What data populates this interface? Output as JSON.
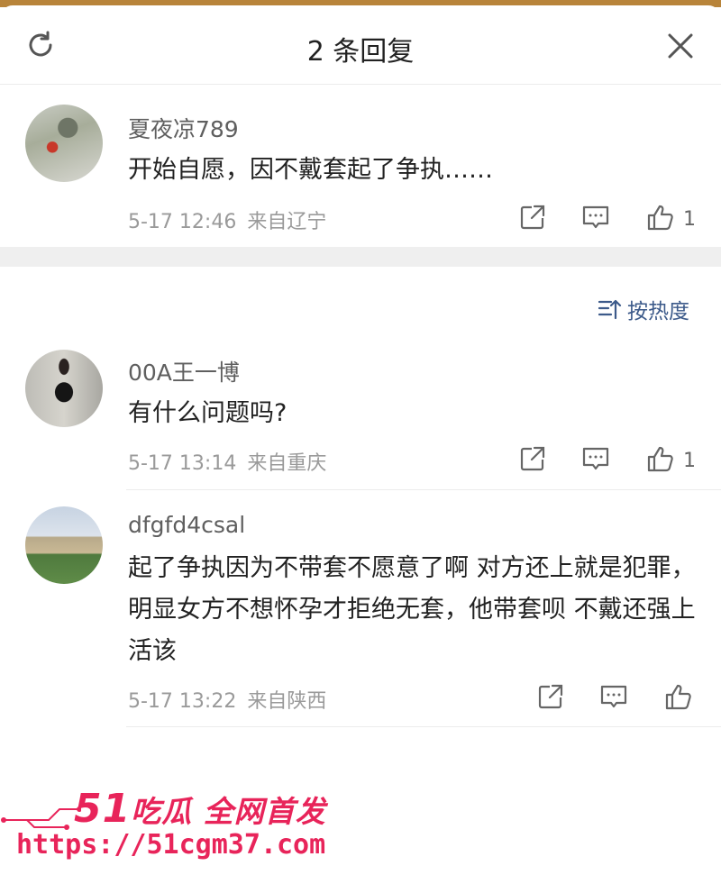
{
  "header": {
    "title": "2 条回复"
  },
  "original_comment": {
    "username": "夏夜凉789",
    "text": "开始自愿，因不戴套起了争执……",
    "time": "5-17 12:46",
    "location": "来自辽宁",
    "likes": "1"
  },
  "sort": {
    "label": "按热度"
  },
  "replies": [
    {
      "username": "00A王一博",
      "text": "有什么问题吗?",
      "time": "5-17 13:14",
      "location": "来自重庆",
      "likes": "1"
    },
    {
      "username": "dfgfd4csal",
      "text": "起了争执因为不带套不愿意了啊 对方还上就是犯罪，明显女方不想怀孕才拒绝无套，他带套呗 不戴还强上 活该",
      "time": "5-17 13:22",
      "location": "来自陕西",
      "likes": ""
    }
  ],
  "watermark": {
    "brand_number": "51",
    "brand_text": "吃瓜 全网首发",
    "url": "https://51cgm37.com"
  },
  "colors": {
    "accent_blue": "#3c5a8a",
    "watermark_pink": "#e8245a"
  }
}
